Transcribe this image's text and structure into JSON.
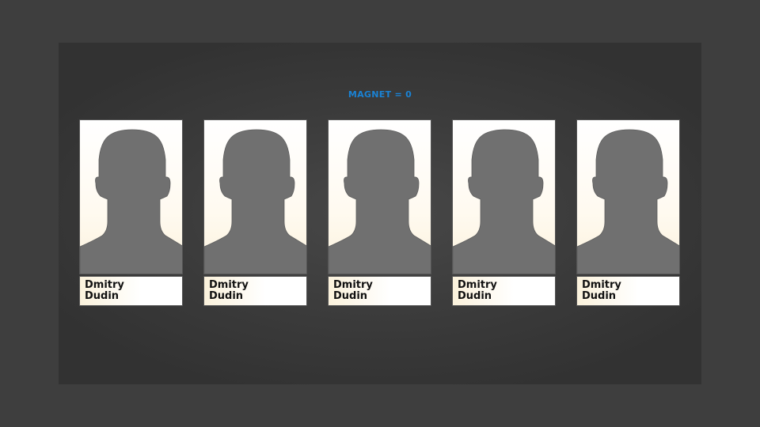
{
  "header": {
    "magnet_label": "MAGNET = 0"
  },
  "colors": {
    "accent": "#1a82d4",
    "silhouette": "#707070",
    "background": "#3e3e3e"
  },
  "cards": [
    {
      "first_name": "Dmitry",
      "last_name": "Dudin",
      "icon": "person-silhouette-icon"
    },
    {
      "first_name": "Dmitry",
      "last_name": "Dudin",
      "icon": "person-silhouette-icon"
    },
    {
      "first_name": "Dmitry",
      "last_name": "Dudin",
      "icon": "person-silhouette-icon"
    },
    {
      "first_name": "Dmitry",
      "last_name": "Dudin",
      "icon": "person-silhouette-icon"
    },
    {
      "first_name": "Dmitry",
      "last_name": "Dudin",
      "icon": "person-silhouette-icon"
    }
  ]
}
